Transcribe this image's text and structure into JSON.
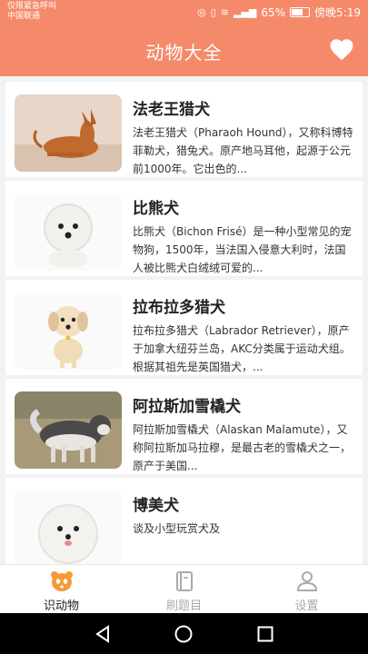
{
  "status_bar": {
    "carrier_line1": "仅限紧急呼叫",
    "carrier_line2": "中国联通",
    "battery": "65%",
    "time": "傍晚5:19"
  },
  "app_bar": {
    "title": "动物大全",
    "favorite_icon": "heart-icon"
  },
  "animals": [
    {
      "name": "法老王猎犬",
      "description": "法老王猎犬（Pharaoh Hound），又称科博特菲勒犬，猎兔犬。原产地马耳他，起源于公元前1000年。它出色的..."
    },
    {
      "name": "比熊犬",
      "description": "比熊犬（Bichon Frisé）是一种小型常见的宠物狗，1500年，当法国入侵意大利时，法国人被比熊犬白绒绒可爱的..."
    },
    {
      "name": "拉布拉多猎犬",
      "description": "拉布拉多猎犬（Labrador Retriever），原产于加拿大纽芬兰岛，AKC分类属于运动犬组。根据其祖先是英国猎犬，..."
    },
    {
      "name": "阿拉斯加雪橇犬",
      "description": "阿拉斯加雪橇犬（Alaskan Malamute），又称阿拉斯加马拉穆，是最古老的雪橇犬之一，原产于美国..."
    },
    {
      "name": "博美犬",
      "description": "谈及小型玩赏犬及"
    }
  ],
  "bottom_nav": [
    {
      "label": "识动物",
      "icon": "panda-icon",
      "active": true
    },
    {
      "label": "刷题目",
      "icon": "book-icon",
      "active": false
    },
    {
      "label": "设置",
      "icon": "person-icon",
      "active": false
    }
  ],
  "colors": {
    "accent": "#f58a6a",
    "nav_active_icon": "#f59a3a",
    "nav_inactive": "#aaaaaa"
  }
}
